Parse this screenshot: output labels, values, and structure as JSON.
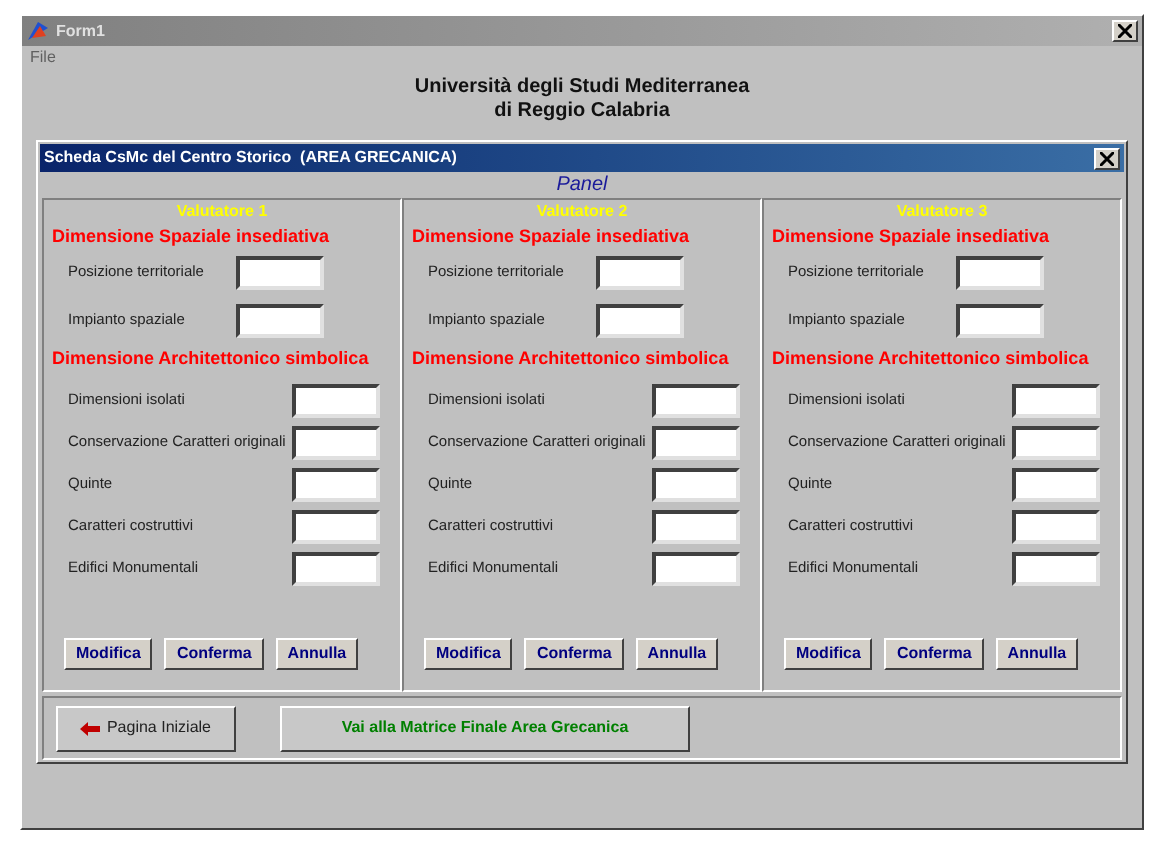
{
  "window": {
    "title": "Form1"
  },
  "menu": [
    "File"
  ],
  "heading": [
    "Università degli Studi Mediterranea",
    "di Reggio Calabria"
  ],
  "dialog": {
    "title": "Scheda CsMc del Centro Storico  (AREA GRECANICA)",
    "panel_label": "Panel",
    "columns": [
      {
        "title": "Valutatore 1",
        "sections": [
          {
            "heading": "Dimensione Spaziale insediativa",
            "fields": [
              "Posizione territoriale",
              "Impianto spaziale"
            ]
          },
          {
            "heading": "Dimensione Architettonico simbolica",
            "fields": [
              "Dimensioni isolati",
              "Conservazione Caratteri originali",
              "Quinte",
              "Caratteri costruttivi",
              "Edifici Monumentali"
            ]
          }
        ],
        "buttons": [
          "Modifica",
          "Conferma",
          "Annulla"
        ]
      },
      {
        "title": "Valutatore 2",
        "sections": [
          {
            "heading": "Dimensione Spaziale insediativa",
            "fields": [
              "Posizione territoriale",
              "Impianto spaziale"
            ]
          },
          {
            "heading": "Dimensione Architettonico simbolica",
            "fields": [
              "Dimensioni isolati",
              "Conservazione Caratteri originali",
              "Quinte",
              "Caratteri costruttivi",
              "Edifici Monumentali"
            ]
          }
        ],
        "buttons": [
          "Modifica",
          "Conferma",
          "Annulla"
        ]
      },
      {
        "title": "Valutatore 3",
        "sections": [
          {
            "heading": "Dimensione Spaziale insediativa",
            "fields": [
              "Posizione territoriale",
              "Impianto spaziale"
            ]
          },
          {
            "heading": "Dimensione Architettonico simbolica",
            "fields": [
              "Dimensioni isolati",
              "Conservazione Caratteri originali",
              "Quinte",
              "Caratteri costruttivi",
              "Edifici Monumentali"
            ]
          }
        ],
        "buttons": [
          "Modifica",
          "Conferma",
          "Annulla"
        ]
      }
    ],
    "back_button": "Pagina Iniziale",
    "next_button": "Vai alla Matrice Finale Area Grecanica"
  }
}
